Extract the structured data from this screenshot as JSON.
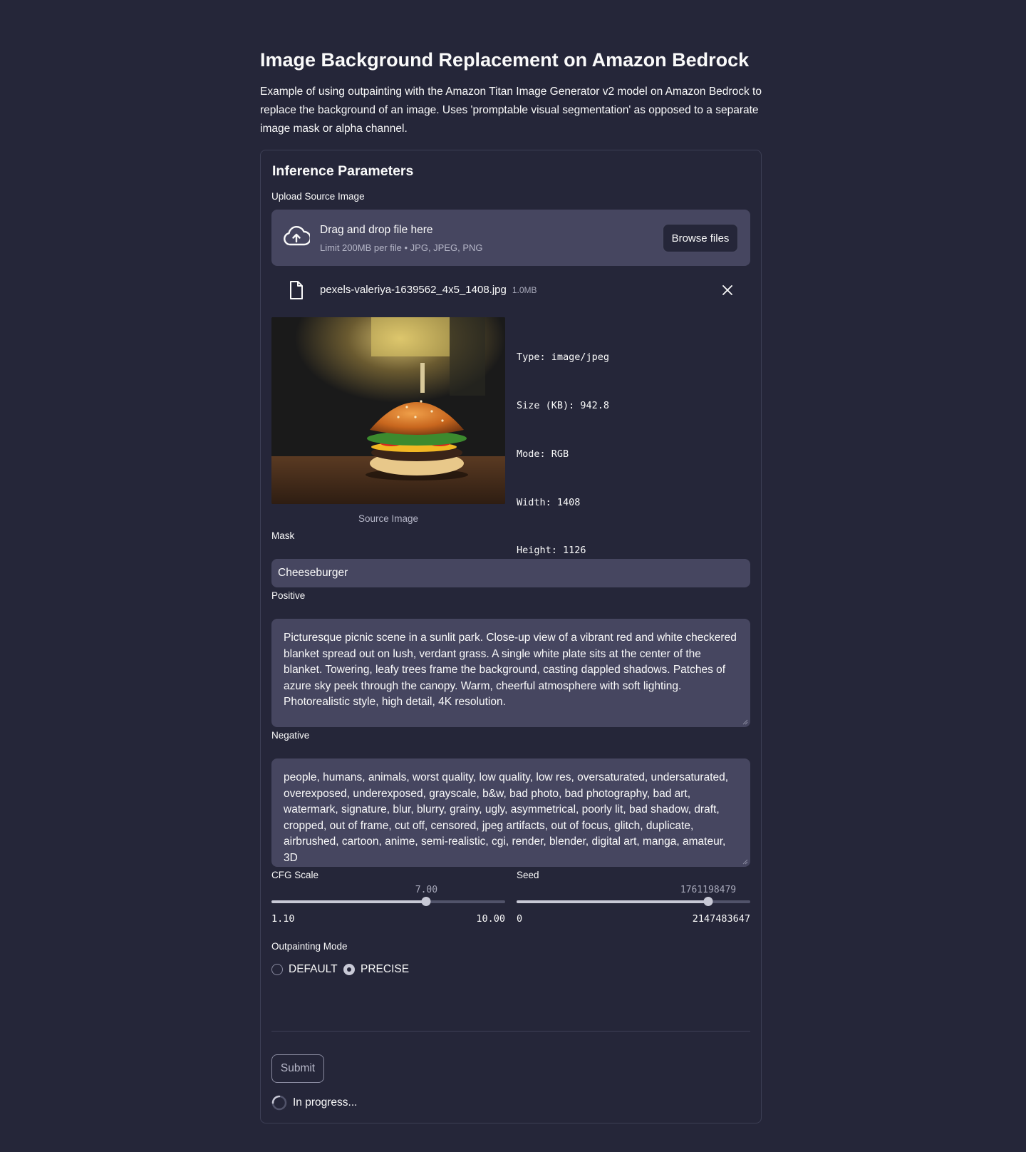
{
  "page": {
    "title": "Image Background Replacement on Amazon Bedrock",
    "description": "Example of using outpainting with the Amazon Titan Image Generator v2 model on Amazon Bedrock to replace the background of an image. Uses 'promptable visual segmentation' as opposed to a separate image mask or alpha channel."
  },
  "form": {
    "section_title": "Inference Parameters",
    "upload": {
      "label": "Upload Source Image",
      "drop_title": "Drag and drop file here",
      "drop_subtitle": "Limit 200MB per file • JPG, JPEG, PNG",
      "browse_label": "Browse files",
      "file_name": "pexels-valeriya-1639562_4x5_1408.jpg",
      "file_size": "1.0MB"
    },
    "image": {
      "caption": "Source Image",
      "meta_lines": [
        "Type: image/jpeg",
        "Size (KB): 942.8",
        "Mode: RGB",
        "Width: 1408",
        "Height: 1126"
      ]
    },
    "mask": {
      "label": "Mask",
      "value": "Cheeseburger"
    },
    "positive": {
      "label": "Positive",
      "value": "Picturesque picnic scene in a sunlit park. Close-up view of a vibrant red and white checkered blanket spread out on lush, verdant grass. A single white plate sits at the center of the blanket. Towering, leafy trees frame the background, casting dappled shadows. Patches of azure sky peek through the canopy. Warm, cheerful atmosphere with soft lighting. Photorealistic style, high detail, 4K resolution."
    },
    "negative": {
      "label": "Negative",
      "value": "people, humans, animals, worst quality, low quality, low res, oversaturated, undersaturated, overexposed, underexposed, grayscale, b&w, bad photo, bad photography, bad art, watermark, signature, blur, blurry, grainy, ugly, asymmetrical, poorly lit, bad shadow, draft, cropped, out of frame, cut off, censored, jpeg artifacts, out of focus, glitch, duplicate, airbrushed, cartoon, anime, semi-realistic, cgi, render, blender, digital art, manga, amateur, 3D"
    },
    "cfg_scale": {
      "label": "CFG Scale",
      "value": 7.0,
      "value_text": "7.00",
      "min": 1.1,
      "min_text": "1.10",
      "max": 10.0,
      "max_text": "10.00"
    },
    "seed": {
      "label": "Seed",
      "value": 1761198479,
      "value_text": "1761198479",
      "min": 0,
      "min_text": "0",
      "max": 2147483647,
      "max_text": "2147483647"
    },
    "outpainting": {
      "label": "Outpainting Mode",
      "options": [
        "DEFAULT",
        "PRECISE"
      ],
      "selected": "PRECISE"
    },
    "submit_label": "Submit",
    "status_text": "In progress..."
  },
  "colors": {
    "background": "#252639",
    "input_bg": "#464660",
    "text": "#fafafa",
    "slider": "#c8c9d6"
  },
  "icons": {
    "upload": "cloud-upload-icon",
    "file": "file-icon",
    "close": "close-icon",
    "spinner": "spinner-icon"
  }
}
